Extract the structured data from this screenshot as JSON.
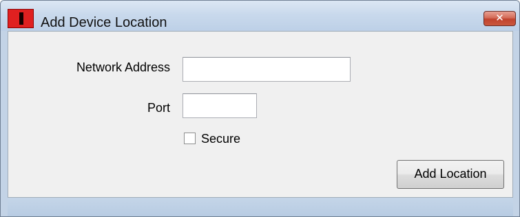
{
  "window": {
    "title": "Add Device Location",
    "close_glyph": "✕",
    "app_icon": "app-icon-red"
  },
  "form": {
    "network_address": {
      "label": "Network Address",
      "value": ""
    },
    "port": {
      "label": "Port",
      "value": ""
    },
    "secure": {
      "label": "Secure",
      "checked": false
    }
  },
  "actions": {
    "add_location_label": "Add Location"
  },
  "colors": {
    "title_bar": "#c9d9ec",
    "client_bg": "#f0f0f0",
    "close_button": "#c9583f",
    "app_icon": "#e02020"
  }
}
